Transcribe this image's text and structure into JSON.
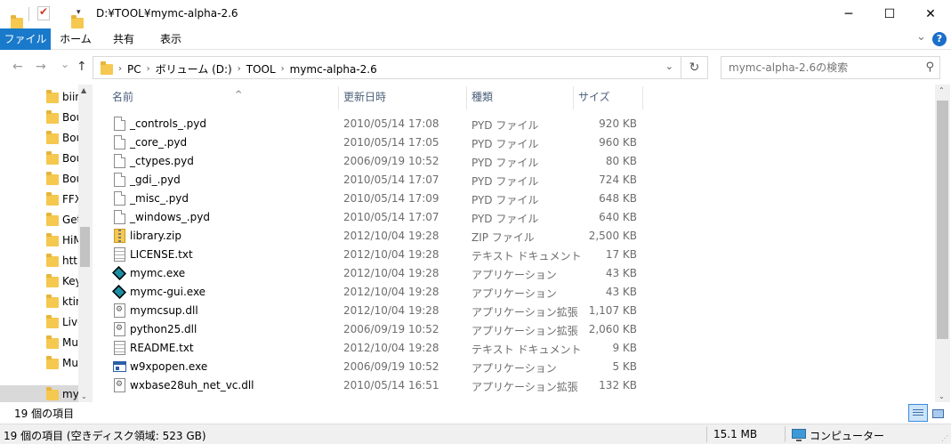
{
  "window": {
    "title": "D:¥TOOL¥mymc-alpha-2.6",
    "minimize_glyph": "─",
    "maximize_glyph": "☐",
    "close_glyph": "✕"
  },
  "ribbon": {
    "tabs": [
      {
        "label": "ファイル",
        "active": true
      },
      {
        "label": "ホーム"
      },
      {
        "label": "共有"
      },
      {
        "label": "表示"
      }
    ],
    "expand_glyph": "⌄",
    "help_glyph": "?"
  },
  "nav": {
    "back_glyph": "←",
    "forward_glyph": "→",
    "recent_glyph": "⌄",
    "up_glyph": "↑",
    "crumbs": [
      "PC",
      "ボリューム (D:)",
      "TOOL",
      "mymc-alpha-2.6"
    ],
    "crumb_sep": "›",
    "dropdown_glyph": "⌄",
    "refresh_glyph": "↻",
    "search_placeholder": "mymc-alpha-2.6の検索",
    "search_glyph": "⚲"
  },
  "navpane": {
    "items": [
      "biin",
      "Bou",
      "Bou",
      "Bou",
      "Bou",
      "FFX",
      "Get",
      "HiM",
      "http",
      "Key",
      "ktin",
      "Live",
      "Mu",
      "Mu",
      "my"
    ],
    "selected_index": 14
  },
  "columns": {
    "name": "名前",
    "date": "更新日時",
    "type": "種類",
    "size": "サイズ",
    "sort_glyph": "^"
  },
  "files": [
    {
      "name": "_controls_.pyd",
      "date": "2010/05/14 17:08",
      "type": "PYD ファイル",
      "size": "920 KB",
      "icon": "doc"
    },
    {
      "name": "_core_.pyd",
      "date": "2010/05/14 17:05",
      "type": "PYD ファイル",
      "size": "960 KB",
      "icon": "doc"
    },
    {
      "name": "_ctypes.pyd",
      "date": "2006/09/19 10:52",
      "type": "PYD ファイル",
      "size": "80 KB",
      "icon": "doc"
    },
    {
      "name": "_gdi_.pyd",
      "date": "2010/05/14 17:07",
      "type": "PYD ファイル",
      "size": "724 KB",
      "icon": "doc"
    },
    {
      "name": "_misc_.pyd",
      "date": "2010/05/14 17:09",
      "type": "PYD ファイル",
      "size": "648 KB",
      "icon": "doc"
    },
    {
      "name": "_windows_.pyd",
      "date": "2010/05/14 17:07",
      "type": "PYD ファイル",
      "size": "640 KB",
      "icon": "doc"
    },
    {
      "name": "library.zip",
      "date": "2012/10/04 19:28",
      "type": "ZIP ファイル",
      "size": "2,500 KB",
      "icon": "zip"
    },
    {
      "name": "LICENSE.txt",
      "date": "2012/10/04 19:28",
      "type": "テキスト ドキュメント",
      "size": "17 KB",
      "icon": "txt"
    },
    {
      "name": "mymc.exe",
      "date": "2012/10/04 19:28",
      "type": "アプリケーション",
      "size": "43 KB",
      "icon": "exe"
    },
    {
      "name": "mymc-gui.exe",
      "date": "2012/10/04 19:28",
      "type": "アプリケーション",
      "size": "43 KB",
      "icon": "exe"
    },
    {
      "name": "mymcsup.dll",
      "date": "2012/10/04 19:28",
      "type": "アプリケーション拡張",
      "size": "1,107 KB",
      "icon": "dll"
    },
    {
      "name": "python25.dll",
      "date": "2006/09/19 10:52",
      "type": "アプリケーション拡張",
      "size": "2,060 KB",
      "icon": "dll"
    },
    {
      "name": "README.txt",
      "date": "2012/10/04 19:28",
      "type": "テキスト ドキュメント",
      "size": "9 KB",
      "icon": "txt"
    },
    {
      "name": "w9xpopen.exe",
      "date": "2006/09/19 10:52",
      "type": "アプリケーション",
      "size": "5 KB",
      "icon": "win"
    },
    {
      "name": "wxbase28uh_net_vc.dll",
      "date": "2010/05/14 16:51",
      "type": "アプリケーション拡張",
      "size": "132 KB",
      "icon": "dll"
    }
  ],
  "status": {
    "count": "19 個の項目",
    "info": "19 個の項目 (空きディスク領域: 523 GB)",
    "total_size": "15.1 MB",
    "location": "コンピューター"
  },
  "scroll_glyphs": {
    "up": "▲",
    "down": "▼",
    "chevron_up": "⌃",
    "chevron_down": "⌄",
    "grip": "⋰"
  }
}
